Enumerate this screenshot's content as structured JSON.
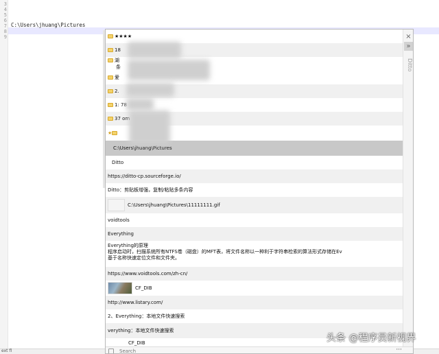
{
  "editor": {
    "line_numbers": [
      "3",
      "4",
      "5",
      "6",
      "7",
      "8",
      "9"
    ],
    "code_line": "C:\\Users\\jhuang\\Pictures",
    "status_text": "ext fl"
  },
  "ditto": {
    "side_title": "Ditto",
    "close_glyph": "×",
    "expand_glyph": "»",
    "search_placeholder": "Search",
    "more_glyph": "···",
    "clips": [
      {
        "text": "★★★★",
        "folder": true
      },
      {
        "text": "18",
        "folder": true
      },
      {
        "text": "湖",
        "folder": true
      },
      {
        "text": "条",
        "folder": false
      },
      {
        "text": "爱",
        "folder": true
      },
      {
        "text": "2.",
        "folder": true
      },
      {
        "text": "1:      78",
        "folder": true
      },
      {
        "text": "37             om",
        "folder": true
      },
      {
        "text": "★",
        "folder": true
      },
      {
        "text": "C:\\Users\\jhuang\\Pictures",
        "folder": false
      },
      {
        "text": "Ditto",
        "folder": false
      },
      {
        "text": "https://ditto-cp.sourceforge.io/",
        "folder": false
      },
      {
        "text": "Ditto：剪贴板增强，复制/粘贴多条内容",
        "folder": false
      },
      {
        "text": "C:\\Users\\jhuang\\Pictures\\11111111.gif",
        "folder": false
      },
      {
        "text": "voidtools",
        "folder": false
      },
      {
        "text": "Everything",
        "folder": false
      },
      {
        "text": "Everything的原理",
        "folder": false
      },
      {
        "text": "程序启动时，扫描系统所有NTFS卷（磁盘）的MFT表，将文件名称以一种利于字符串检索的算法形式存储在Ev",
        "folder": false
      },
      {
        "text": "基于名称快速定位文件和文件夹。",
        "folder": false
      },
      {
        "text": "https://www.voidtools.com/zh-cn/",
        "folder": false
      },
      {
        "text": "CF_DIB",
        "folder": false
      },
      {
        "text": "http://www.listary.com/",
        "folder": false
      },
      {
        "text": "2、Everything：本地文件快速搜索",
        "folder": false
      },
      {
        "text": "verything：本地文件快速搜索",
        "folder": false
      },
      {
        "text": "CF_DIB",
        "folder": false
      }
    ]
  },
  "watermark": "头条 @程序员新视界"
}
